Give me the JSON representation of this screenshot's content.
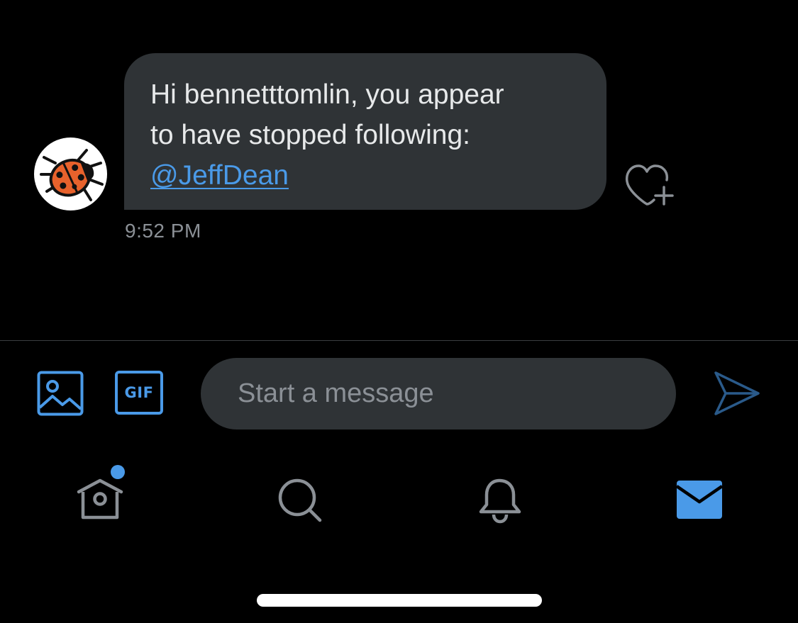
{
  "conversation": {
    "message": {
      "line1": "Hi bennetttomlin, you appear",
      "line2": "to have stopped following:",
      "mention": "@JeffDean",
      "timestamp": "9:52 PM"
    },
    "sender_avatar": "ladybug-avatar",
    "like_icon": "heart-plus-icon"
  },
  "composer": {
    "media_icon": "image-icon",
    "gif_label": "GIF",
    "placeholder": "Start a message",
    "value": "",
    "send_icon": "send-icon"
  },
  "tab_bar": {
    "items": [
      {
        "icon": "home-icon",
        "has_notification_dot": true,
        "active": false
      },
      {
        "icon": "search-icon",
        "active": false
      },
      {
        "icon": "bell-icon",
        "active": false
      },
      {
        "icon": "mail-icon",
        "active": true
      }
    ]
  },
  "colors": {
    "background": "#000000",
    "bubble": "#2f3336",
    "accent": "#4a9ae8",
    "muted_text": "#8b9096",
    "text": "#e7e9ea"
  }
}
